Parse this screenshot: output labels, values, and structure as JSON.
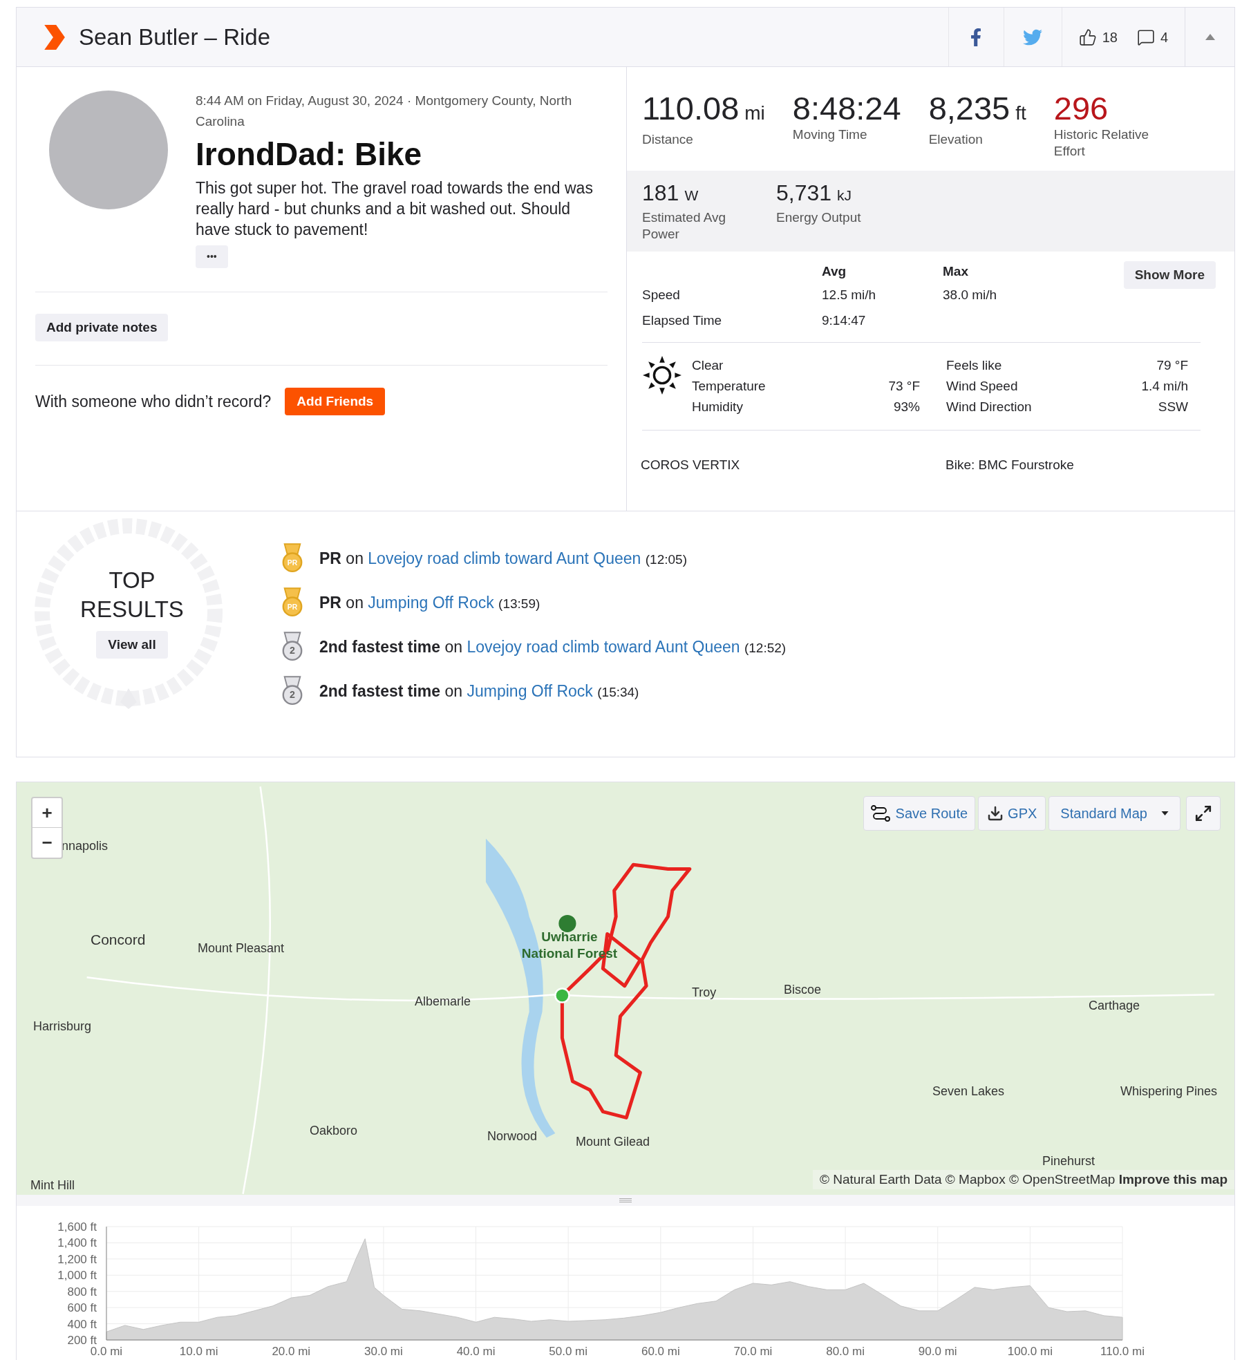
{
  "header": {
    "title": "Sean Butler – Ride",
    "kudos": "18",
    "comments": "4"
  },
  "activity": {
    "date_location": "8:44 AM on Friday, August 30, 2024 · Montgomery County, North Carolina",
    "name": "IrondDad: Bike",
    "description": "This got super hot. The gravel road towards the end was really hard - but chunks and a bit washed out. Should have stuck to pavement!",
    "more_button": "•••",
    "private_notes_button": "Add private notes",
    "friends_prompt": "With someone who didn’t record?",
    "friends_button": "Add Friends"
  },
  "primary_stats": [
    {
      "value": "110.08",
      "unit": "mi",
      "label": "Distance",
      "emphasis": false
    },
    {
      "value": "8:48:24",
      "label": "Moving Time",
      "emphasis": false
    },
    {
      "value": "8,235",
      "unit": "ft",
      "label": "Elevation",
      "emphasis": false
    },
    {
      "value": "296",
      "label": "Historic Relative Effort",
      "emphasis": true
    }
  ],
  "secondary_stats": [
    {
      "value": "181",
      "unit": "W",
      "label": "Estimated Avg Power"
    },
    {
      "value": "5,731",
      "unit": "kJ",
      "label": "Energy Output"
    }
  ],
  "more_stats": {
    "columns": [
      "Avg",
      "Max"
    ],
    "show_more_button": "Show More",
    "rows": [
      {
        "label": "Speed",
        "avg": "12.5 mi/h",
        "max": "38.0 mi/h"
      },
      {
        "label": "Elapsed Time",
        "avg": "9:14:47"
      }
    ]
  },
  "weather": {
    "condition": "Clear",
    "left": [
      {
        "label": "Temperature",
        "value": "73 °F"
      },
      {
        "label": "Humidity",
        "value": "93%"
      }
    ],
    "right": [
      {
        "label": "Feels like",
        "value": "79 °F"
      },
      {
        "label": "Wind Speed",
        "value": "1.4 mi/h"
      },
      {
        "label": "Wind Direction",
        "value": "SSW"
      }
    ]
  },
  "device": "COROS VERTIX",
  "gear": "Bike: BMC Fourstroke",
  "top_results": {
    "title": "TOP RESULTS",
    "view_all_button": "View all",
    "items": [
      {
        "kind": "pr",
        "badge": "PR",
        "achievement": "PR",
        "connector": "on",
        "segment": "Lovejoy road climb toward Aunt Queen",
        "time": "(12:05)"
      },
      {
        "kind": "pr",
        "badge": "PR",
        "achievement": "PR",
        "connector": "on",
        "segment": "Jumping Off Rock",
        "time": "(13:59)"
      },
      {
        "kind": "second",
        "badge": "2",
        "achievement": "2nd fastest time",
        "connector": "on",
        "segment": "Lovejoy road climb toward Aunt Queen",
        "time": "(12:52)"
      },
      {
        "kind": "second",
        "badge": "2",
        "achievement": "2nd fastest time",
        "connector": "on",
        "segment": "Jumping Off Rock",
        "time": "(15:34)"
      }
    ]
  },
  "map": {
    "zoom_in": "+",
    "zoom_out": "−",
    "save_route_button": "Save Route",
    "gpx_button": "GPX",
    "map_style_dropdown": "Standard Map",
    "attribution": "© Natural Earth Data © Mapbox © OpenStreetMap",
    "improve_link": "Improve this map",
    "places": [
      {
        "name": "nnapolis",
        "kind": "town"
      },
      {
        "name": "Concord",
        "kind": "city"
      },
      {
        "name": "Mount Pleasant",
        "kind": "town"
      },
      {
        "name": "Harrisburg",
        "kind": "town"
      },
      {
        "name": "Albemarle",
        "kind": "town"
      },
      {
        "name": "Uwharrie National Forest",
        "kind": "park"
      },
      {
        "name": "Troy",
        "kind": "town"
      },
      {
        "name": "Biscoe",
        "kind": "town"
      },
      {
        "name": "Carthage",
        "kind": "town"
      },
      {
        "name": "Seven Lakes",
        "kind": "town"
      },
      {
        "name": "Whispering Pines",
        "kind": "town"
      },
      {
        "name": "Oakboro",
        "kind": "town"
      },
      {
        "name": "Norwood",
        "kind": "town"
      },
      {
        "name": "Mount Gilead",
        "kind": "town"
      },
      {
        "name": "Pinehurst",
        "kind": "town"
      },
      {
        "name": "Mint Hill",
        "kind": "town"
      }
    ]
  },
  "elevation": {
    "chart_data": {
      "type": "area",
      "x": [
        0,
        2,
        4,
        6,
        8,
        10,
        12,
        14,
        16,
        18,
        20,
        22,
        24,
        26,
        27,
        28,
        29,
        30,
        32,
        34,
        36,
        38,
        40,
        42,
        44,
        46,
        48,
        50,
        52,
        54,
        56,
        58,
        60,
        62,
        64,
        66,
        68,
        70,
        72,
        74,
        76,
        78,
        80,
        82,
        84,
        86,
        88,
        90,
        92,
        94,
        96,
        98,
        100,
        102,
        104,
        106,
        108,
        110
      ],
      "grid": true,
      "series": [
        {
          "color": "#d6d6d6",
          "values": [
            300,
            380,
            330,
            380,
            420,
            420,
            480,
            500,
            560,
            620,
            720,
            750,
            860,
            920,
            1200,
            1450,
            850,
            750,
            580,
            560,
            520,
            480,
            420,
            480,
            460,
            430,
            450,
            430,
            440,
            450,
            470,
            500,
            540,
            600,
            650,
            680,
            820,
            900,
            880,
            920,
            860,
            820,
            820,
            900,
            760,
            620,
            560,
            560,
            700,
            850,
            820,
            850,
            870,
            600,
            550,
            560,
            500,
            480
          ]
        }
      ],
      "xlim": [
        0,
        110
      ],
      "ylim": [
        200,
        1600
      ],
      "xticks": [
        {
          "value": 0,
          "label": "0.0 mi"
        },
        {
          "value": 10,
          "label": "10.0 mi"
        },
        {
          "value": 20,
          "label": "20.0 mi"
        },
        {
          "value": 30,
          "label": "30.0 mi"
        },
        {
          "value": 40,
          "label": "40.0 mi"
        },
        {
          "value": 50,
          "label": "50.0 mi"
        },
        {
          "value": 60,
          "label": "60.0 mi"
        },
        {
          "value": 70,
          "label": "70.0 mi"
        },
        {
          "value": 80,
          "label": "80.0 mi"
        },
        {
          "value": 90,
          "label": "90.0 mi"
        },
        {
          "value": 100,
          "label": "100.0 mi"
        },
        {
          "value": 110,
          "label": "110.0 mi"
        }
      ],
      "yticks": [
        {
          "value": 200,
          "label": "200 ft"
        },
        {
          "value": 400,
          "label": "400 ft"
        },
        {
          "value": 600,
          "label": "600 ft"
        },
        {
          "value": 800,
          "label": "800 ft"
        },
        {
          "value": 1000,
          "label": "1,000 ft"
        },
        {
          "value": 1200,
          "label": "1,200 ft"
        },
        {
          "value": 1400,
          "label": "1,400 ft"
        },
        {
          "value": 1600,
          "label": "1,600 ft"
        }
      ]
    }
  }
}
